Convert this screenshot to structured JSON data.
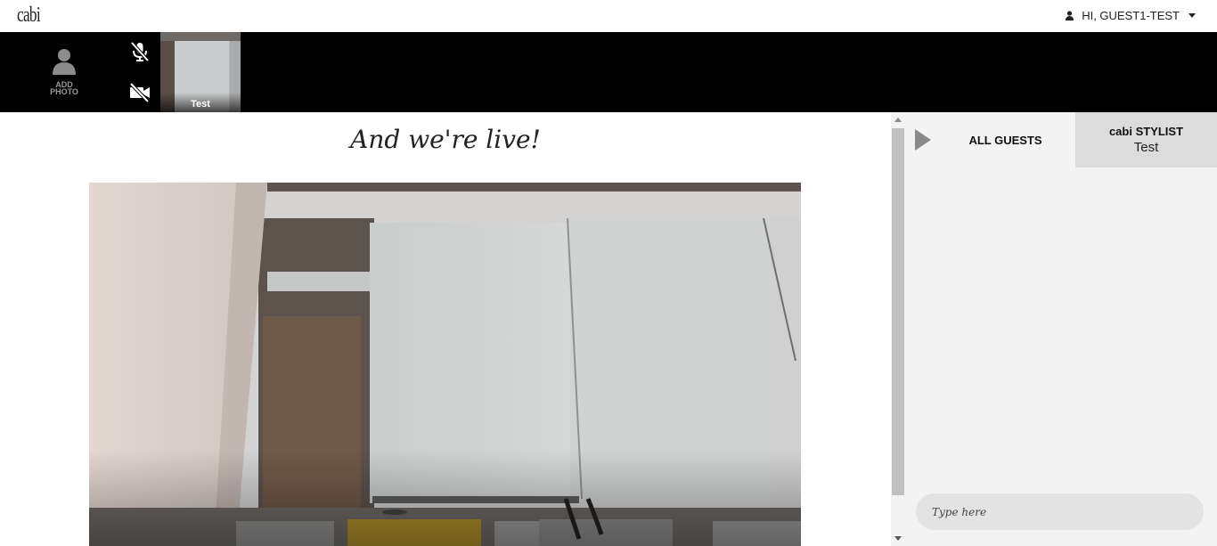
{
  "header": {
    "logo": "cabi",
    "user_greeting": "HI, GUEST1-TEST"
  },
  "strip": {
    "add_photo_label_1": "ADD",
    "add_photo_label_2": "PHOTO",
    "participant_name": "Test"
  },
  "main": {
    "title": "And we're live!"
  },
  "chat": {
    "tab_all_guests": "ALL GUESTS",
    "tab_stylist_title": "cabi STYLIST",
    "tab_stylist_name": "Test",
    "input_placeholder": "Type here"
  }
}
